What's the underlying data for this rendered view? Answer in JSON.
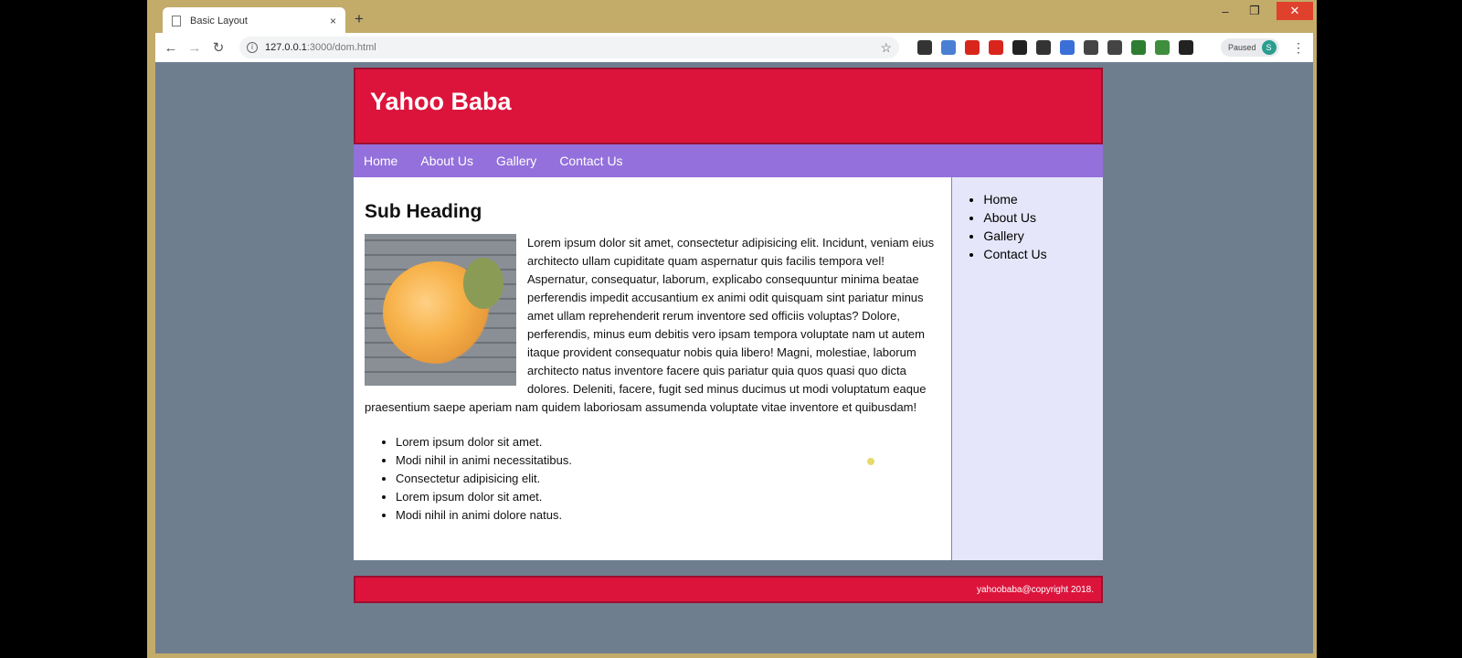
{
  "browser": {
    "tab_title": "Basic Layout",
    "tab_close": "×",
    "new_tab": "+",
    "url_host": "127.0.0.1",
    "url_path": ":3000/dom.html",
    "profile_label": "Paused",
    "profile_initial": "S",
    "window_controls": {
      "minimize": "–",
      "maximize": "❐",
      "close": "✕"
    },
    "nav": {
      "back": "←",
      "forward": "→",
      "reload": "↻",
      "info": "i",
      "star": "☆",
      "menu": "⋮"
    },
    "extension_colors": [
      "#333333",
      "#4a7fd4",
      "#d9261c",
      "#d9261c",
      "#222222",
      "#333333",
      "#3b6fd8",
      "#444444",
      "#444444",
      "#2e7d32",
      "#3e8e3e",
      "#222222"
    ]
  },
  "site": {
    "title": "Yahoo Baba",
    "nav": [
      "Home",
      "About Us",
      "Gallery",
      "Contact Us"
    ],
    "sub_heading": "Sub Heading",
    "paragraph": "Lorem ipsum dolor sit amet, consectetur adipisicing elit. Incidunt, veniam eius architecto ullam cupiditate quam aspernatur quis facilis tempora vel! Aspernatur, consequatur, laborum, explicabo consequuntur minima beatae perferendis impedit accusantium ex animi odit quisquam sint pariatur minus amet ullam reprehenderit rerum inventore sed officiis voluptas? Dolore, perferendis, minus eum debitis vero ipsam tempora voluptate nam ut autem itaque provident consequatur nobis quia libero! Magni, molestiae, laborum architecto natus inventore facere quis pariatur quia quos quasi quo dicta dolores. Deleniti, facere, fugit sed minus ducimus ut modi voluptatum eaque praesentium saepe aperiam nam quidem laboriosam assumenda voluptate vitae inventore et quibusdam!",
    "list": [
      "Lorem ipsum dolor sit amet.",
      "Modi nihil in animi necessitatibus.",
      "Consectetur adipisicing elit.",
      "Lorem ipsum dolor sit amet.",
      "Modi nihil in animi dolore natus."
    ],
    "sidebar": [
      "Home",
      "About Us",
      "Gallery",
      "Contact Us"
    ],
    "footer": "yahoobaba@copyright 2018.",
    "colors": {
      "header": "#dc143c",
      "nav": "#9370db",
      "sidebar": "#e6e6fa",
      "page_bg": "#6f7e8f"
    }
  }
}
